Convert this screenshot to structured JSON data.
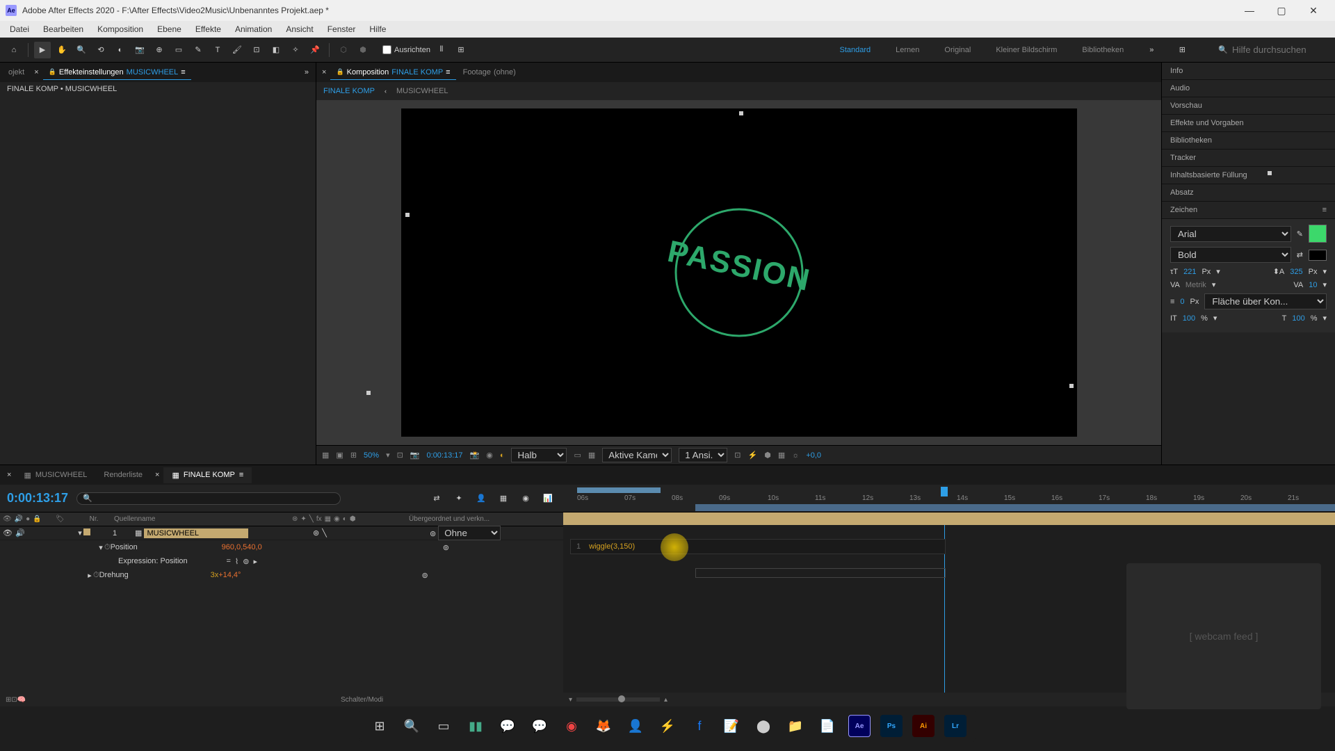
{
  "titlebar": {
    "app": "Ae",
    "title": "Adobe After Effects 2020 - F:\\After Effects\\Video2Music\\Unbenanntes Projekt.aep *"
  },
  "menu": [
    "Datei",
    "Bearbeiten",
    "Komposition",
    "Ebene",
    "Effekte",
    "Animation",
    "Ansicht",
    "Fenster",
    "Hilfe"
  ],
  "toolbar": {
    "align_label": "Ausrichten",
    "workspaces": [
      "Standard",
      "Lernen",
      "Original",
      "Kleiner Bildschirm",
      "Bibliotheken"
    ],
    "active_workspace": "Standard",
    "search_placeholder": "Hilfe durchsuchen"
  },
  "left": {
    "tab_project": "ojekt",
    "tab_effectcontrols": "Effekteinstellungen",
    "tab_comp_name": "MUSICWHEEL",
    "breadcrumb": "FINALE KOMP • MUSICWHEEL"
  },
  "comp_panel": {
    "tab_comp": "Komposition",
    "tab_comp_name": "FINALE KOMP",
    "tab_footage": "Footage",
    "footage_val": "(ohne)",
    "sub_tabs": [
      "FINALE KOMP",
      "MUSICWHEEL"
    ],
    "content_text": "PASSION",
    "zoom": "50%",
    "timecode": "0:00:13:17",
    "res": "Halb",
    "camera": "Aktive Kamera",
    "views": "1 Ansi...",
    "exposure": "+0,0"
  },
  "right": {
    "sections": [
      "Info",
      "Audio",
      "Vorschau",
      "Effekte und Vorgaben",
      "Bibliotheken",
      "Tracker",
      "Inhaltsbasierte Füllung",
      "Absatz"
    ],
    "char_title": "Zeichen",
    "font_family": "Arial",
    "font_style": "Bold",
    "font_size": "221",
    "px_label": "Px",
    "leading": "325",
    "kerning": "Metrik",
    "tracking": "10",
    "stroke": "0",
    "stroke_over": "Fläche über Kon...",
    "scale_v": "100",
    "scale_h": "100",
    "pct": "%"
  },
  "timeline": {
    "tabs": [
      "MUSICWHEEL",
      "Renderliste",
      "FINALE KOMP"
    ],
    "active_tab": "FINALE KOMP",
    "timecode": "0:00:13:17",
    "cols": {
      "nr": "Nr.",
      "quellen": "Quellenname",
      "parent": "Übergeordnet und verkn..."
    },
    "layer1": {
      "nr": "1",
      "name": "MUSICWHEEL",
      "parent": "Ohne"
    },
    "prop_position": "Position",
    "pos_val": "960,0,540,0",
    "expr_label": "Expression: Position",
    "prop_rotation": "Drehung",
    "rot_turns": "3x",
    "rot_deg": "+14,4°",
    "ruler_ticks": [
      "06s",
      "07s",
      "08s",
      "09s",
      "10s",
      "11s",
      "12s",
      "13s",
      "14s",
      "15s",
      "16s",
      "17s",
      "18s",
      "19s",
      "20s",
      "21s"
    ],
    "expression_code": "wiggle(3,150)",
    "footer_label": "Schalter/Modi"
  },
  "webcam_placeholder": "[ webcam feed ]"
}
